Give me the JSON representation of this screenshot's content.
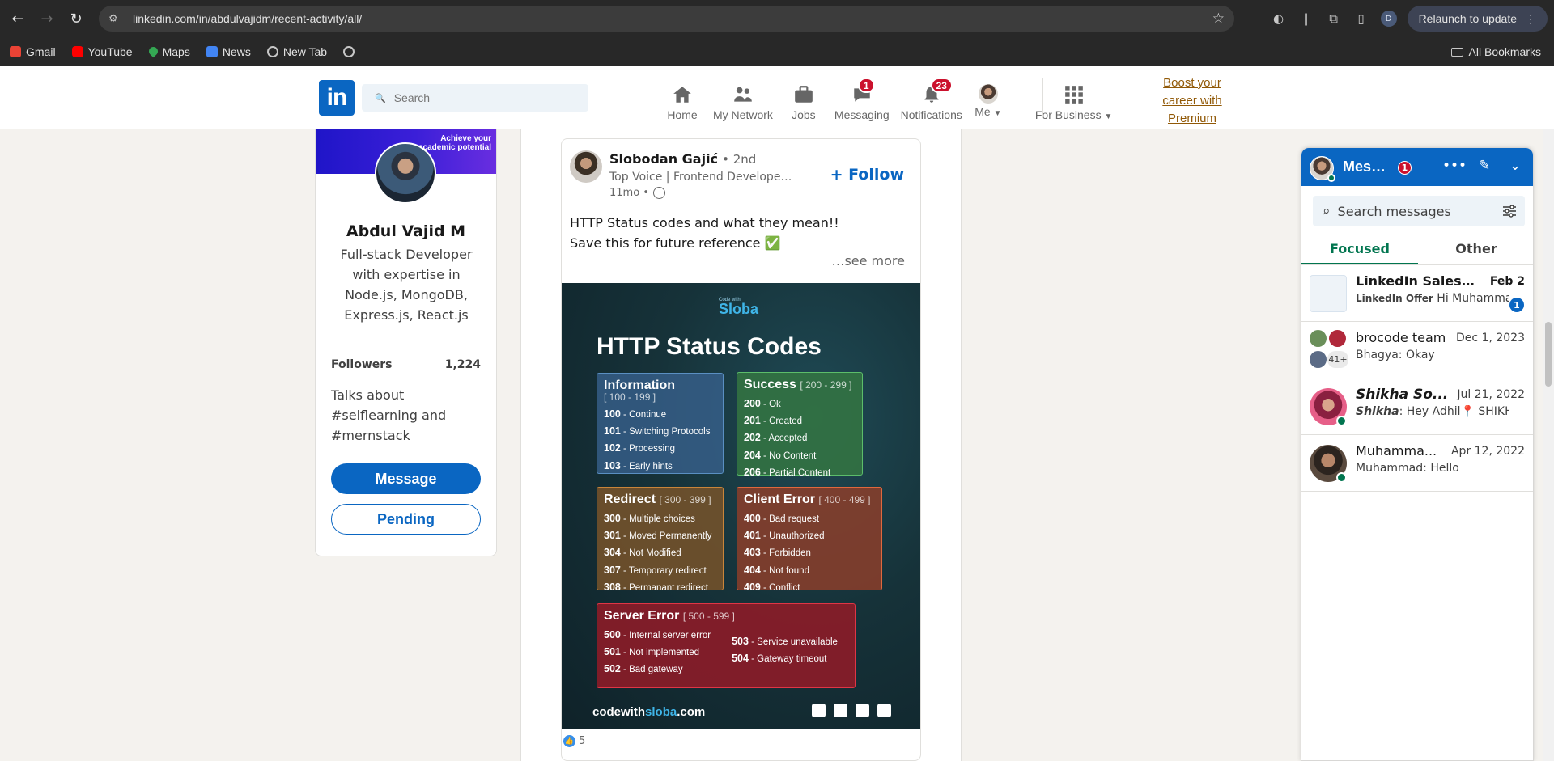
{
  "browser": {
    "url": "linkedin.com/in/abdulvajidm/recent-activity/all/",
    "relaunch_label": "Relaunch to update",
    "profile_initial": "D",
    "bookmarks": [
      {
        "label": "Gmail",
        "icon": "gmail-icon",
        "color": "#ea4335"
      },
      {
        "label": "YouTube",
        "icon": "youtube-icon",
        "color": "#ff0000"
      },
      {
        "label": "Maps",
        "icon": "maps-icon",
        "color": "#34a853"
      },
      {
        "label": "News",
        "icon": "news-icon",
        "color": "#4285f4"
      },
      {
        "label": "New Tab",
        "icon": "globe-icon",
        "color": "#9aa0a6"
      }
    ],
    "all_bookmarks_label": "All Bookmarks"
  },
  "header": {
    "logo": "in",
    "search_placeholder": "Search",
    "nav": [
      {
        "label": "Home",
        "icon": "home-icon"
      },
      {
        "label": "My Network",
        "icon": "network-icon"
      },
      {
        "label": "Jobs",
        "icon": "jobs-icon"
      },
      {
        "label": "Messaging",
        "icon": "messaging-icon",
        "badge": "1"
      },
      {
        "label": "Notifications",
        "icon": "bell-icon",
        "badge": "23"
      },
      {
        "label": "Me",
        "icon": "avatar-icon"
      },
      {
        "label": "For Business",
        "icon": "grid-icon"
      }
    ],
    "premium_line1": "Boost your",
    "premium_line2": "career with",
    "premium_line3": "Premium"
  },
  "profile": {
    "banner_line1": "Achieve your",
    "banner_line2": "academic potential",
    "name": "Abdul Vajid M",
    "headline": "Full-stack Developer with expertise in Node.js, MongoDB, Express.js, React.js",
    "followers_label": "Followers",
    "followers_count": "1,224",
    "talks": "Talks about #selflearning and #mernstack",
    "message_label": "Message",
    "pending_label": "Pending"
  },
  "post": {
    "author": "Slobodan Gajić",
    "degree": "• 2nd",
    "subtitle": "Top Voice | Frontend Develope…",
    "time": "11mo •",
    "follow_label": "+ Follow",
    "text_line1": "HTTP Status codes and what they mean!!",
    "text_line2": "Save this for future reference ✅",
    "see_more": "…see more",
    "reaction_count": "5",
    "infographic": {
      "logo_small": "Code with",
      "logo": "Sloba",
      "title": "HTTP Status Codes",
      "info": {
        "title": "Information",
        "range": "[ 100 - 199 ]",
        "items": [
          [
            "100",
            "Continue"
          ],
          [
            "101",
            "Switching Protocols"
          ],
          [
            "102",
            "Processing"
          ],
          [
            "103",
            "Early hints"
          ]
        ]
      },
      "success": {
        "title": "Success",
        "range": "[ 200 - 299 ]",
        "items": [
          [
            "200",
            "Ok"
          ],
          [
            "201",
            "Created"
          ],
          [
            "202",
            "Accepted"
          ],
          [
            "204",
            "No Content"
          ],
          [
            "206",
            "Partial Content"
          ]
        ]
      },
      "redirect": {
        "title": "Redirect",
        "range": "[ 300 - 399 ]",
        "items": [
          [
            "300",
            "Multiple choices"
          ],
          [
            "301",
            "Moved Permanently"
          ],
          [
            "304",
            "Not Modified"
          ],
          [
            "307",
            "Temporary redirect"
          ],
          [
            "308",
            "Permanant redirect"
          ]
        ]
      },
      "client": {
        "title": "Client Error",
        "range": "[ 400 - 499 ]",
        "items": [
          [
            "400",
            "Bad request"
          ],
          [
            "401",
            "Unauthorized"
          ],
          [
            "403",
            "Forbidden"
          ],
          [
            "404",
            "Not found"
          ],
          [
            "409",
            "Conflict"
          ]
        ]
      },
      "server": {
        "title": "Server Error",
        "range": "[ 500 - 599 ]",
        "items_col1": [
          [
            "500",
            "Internal server error"
          ],
          [
            "501",
            "Not implemented"
          ],
          [
            "502",
            "Bad gateway"
          ]
        ],
        "items_col2": [
          [
            "503",
            "Service unavailable"
          ],
          [
            "504",
            "Gateway timeout"
          ]
        ]
      },
      "footer_a": "codewith",
      "footer_b": "sloba",
      "footer_c": ".com"
    }
  },
  "messaging": {
    "title": "Mes…",
    "badge": "1",
    "search_placeholder": "Search messages",
    "tabs": [
      "Focused",
      "Other"
    ],
    "conversations": [
      {
        "name": "LinkedIn Sales S...",
        "date": "Feb 2",
        "preview_bold": "LinkedIn Offer",
        "preview": "  Hi Muhammad, As a…",
        "unread": "1"
      },
      {
        "name": "brocode team",
        "date": "Dec 1, 2023",
        "preview": "Bhagya: Okay",
        "group_extra": "41+"
      },
      {
        "name": "Shikha So...",
        "date": "Jul 21, 2022",
        "preview_bold": "Shikha",
        "preview": ": Hey Adhil📍 SHIKHA this side I'm…"
      },
      {
        "name": "Muhamma...",
        "date": "Apr 12, 2022",
        "preview": "Muhammad: Hello"
      }
    ]
  }
}
